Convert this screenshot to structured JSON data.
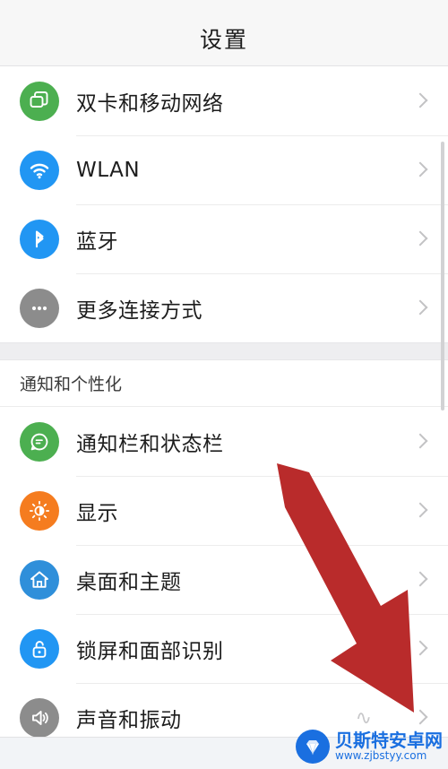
{
  "header": {
    "title": "设置"
  },
  "groups": [
    {
      "section_label": null,
      "rows": [
        {
          "label": "双卡和移动网络",
          "icon": "sim-card-icon",
          "icon_color": "#4CAF50"
        },
        {
          "label": "WLAN",
          "icon": "wifi-icon",
          "icon_color": "#2196F3"
        },
        {
          "label": "蓝牙",
          "icon": "bluetooth-icon",
          "icon_color": "#2196F3"
        },
        {
          "label": "更多连接方式",
          "icon": "more-dots-icon",
          "icon_color": "#8C8C8C"
        }
      ]
    },
    {
      "section_label": "通知和个性化",
      "rows": [
        {
          "label": "通知栏和状态栏",
          "icon": "chat-bubble-icon",
          "icon_color": "#4CAF50"
        },
        {
          "label": "显示",
          "icon": "brightness-icon",
          "icon_color": "#F57C1F"
        },
        {
          "label": "桌面和主题",
          "icon": "home-icon",
          "icon_color": "#2F8FDA"
        },
        {
          "label": "锁屏和面部识别",
          "icon": "unlock-icon",
          "icon_color": "#2196F3"
        },
        {
          "label": "声音和振动",
          "icon": "speaker-icon",
          "icon_color": "#8C8C8C"
        }
      ]
    }
  ],
  "annotation": {
    "arrow_color": "#B92B2B",
    "arrow_direction": "down-right"
  },
  "watermark": {
    "name": "贝斯特安卓网",
    "url": "www.zjbstyy.com"
  },
  "colors": {
    "background": "#FFFFFF",
    "header_background": "#F7F7F7",
    "divider": "#ECECEC",
    "group_gap": "#EEEEF0",
    "chevron": "#C2C2C4"
  }
}
